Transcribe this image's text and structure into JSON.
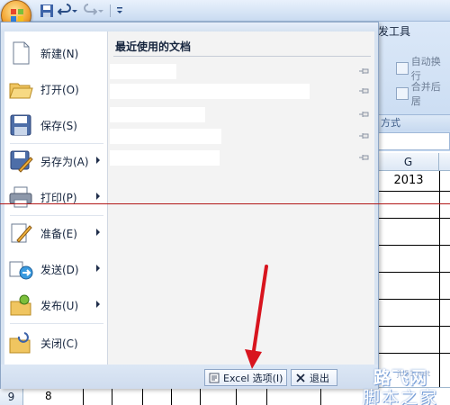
{
  "ribbon": {
    "tab_partial": "发工具",
    "btn_wrap": "自动换行",
    "btn_merge": "合并后居",
    "format_label": "方式"
  },
  "sheet": {
    "col_header": "G",
    "year_value": "2013",
    "row_9": {
      "header": "9",
      "value": "8"
    }
  },
  "office_menu": {
    "items": [
      {
        "label": "新建(N)",
        "icon": "new-document-icon",
        "has_submenu": false
      },
      {
        "label": "打开(O)",
        "icon": "open-folder-icon",
        "has_submenu": false
      },
      {
        "label": "保存(S)",
        "icon": "save-disk-icon",
        "has_submenu": false
      },
      {
        "label": "另存为(A)",
        "icon": "save-as-icon",
        "has_submenu": true
      },
      {
        "label": "打印(P)",
        "icon": "printer-icon",
        "has_submenu": true
      },
      {
        "label": "准备(E)",
        "icon": "prepare-icon",
        "has_submenu": true
      },
      {
        "label": "发送(D)",
        "icon": "send-icon",
        "has_submenu": true
      },
      {
        "label": "发布(U)",
        "icon": "publish-icon",
        "has_submenu": true
      },
      {
        "label": "关闭(C)",
        "icon": "close-folder-icon",
        "has_submenu": false
      }
    ],
    "recent_title": "最近使用的文档",
    "recent_docs_count": 5,
    "options_button": "Excel 选项(I)",
    "exit_button": "退出"
  },
  "watermark": {
    "line1": "路飞网",
    "domain": "jb51.net",
    "line2": "脚本之家"
  },
  "colors": {
    "menu_bg": "#d8e3f1",
    "ribbon_bg": "#c4d8f0",
    "office_button": "#f3a431",
    "annotation_red": "#d8141e"
  }
}
